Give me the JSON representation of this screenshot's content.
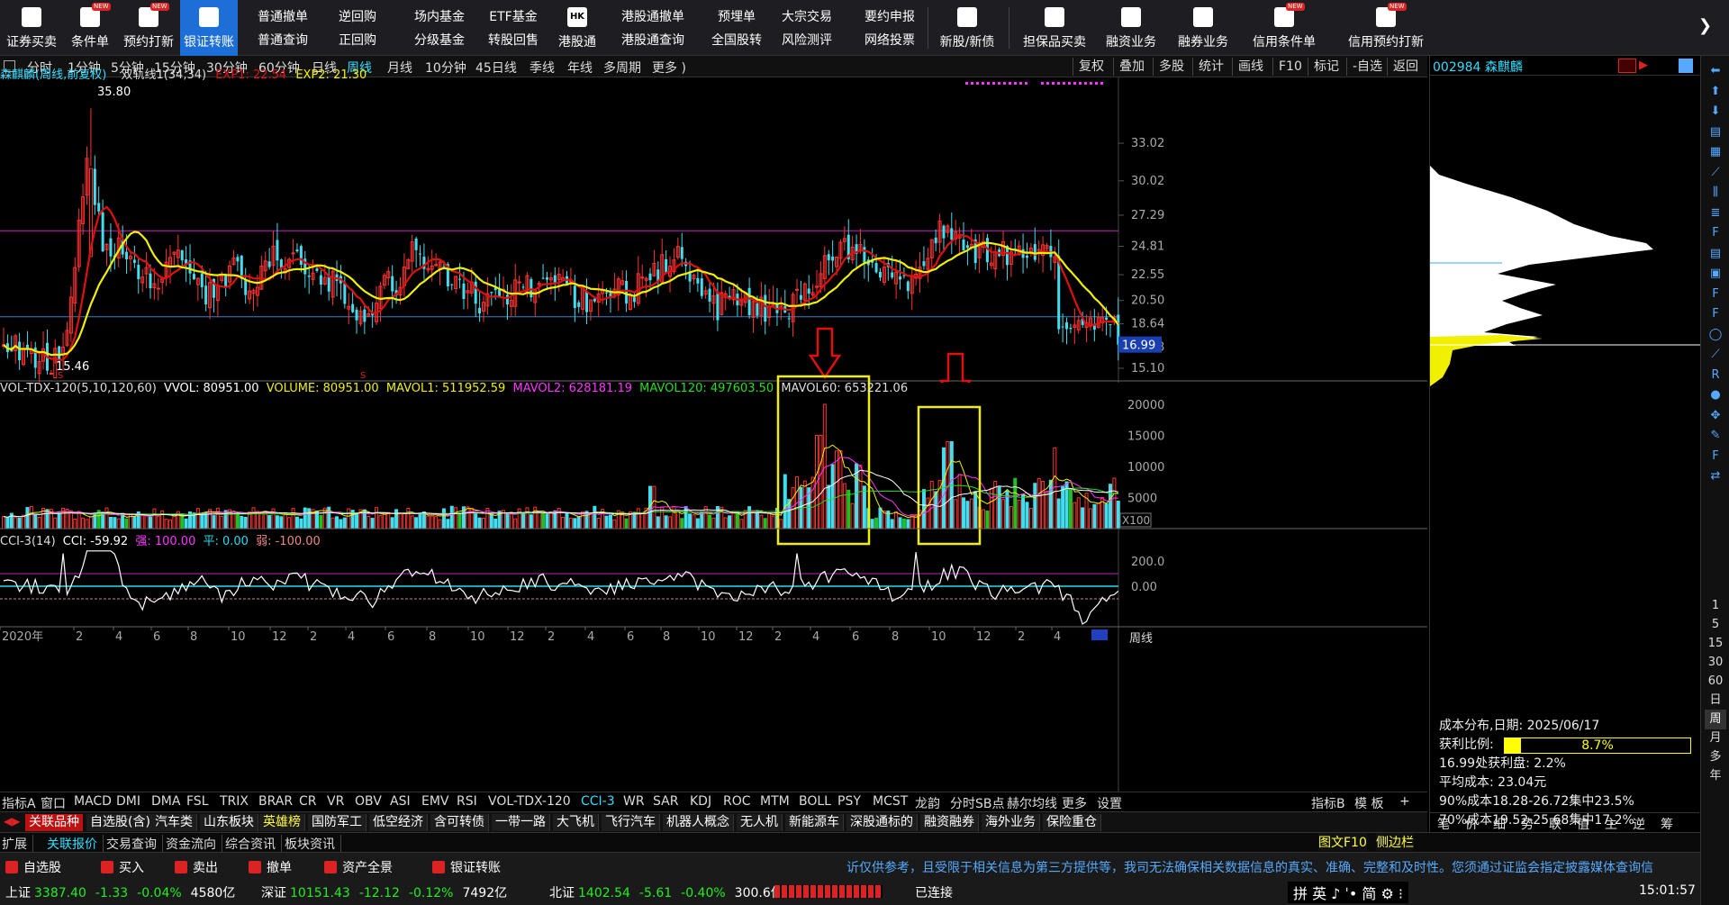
{
  "toolbar": {
    "left": [
      {
        "label": "证券买卖",
        "icon": "trade-icon",
        "new": false
      },
      {
        "label": "条件单",
        "icon": "condition-order-icon",
        "new": true
      },
      {
        "label": "预约打新",
        "icon": "ipo-reserve-icon",
        "new": true
      },
      {
        "label": "银证转账",
        "icon": "bank-transfer-icon",
        "new": false,
        "selected": true
      }
    ],
    "mid": [
      {
        "top": "普通撤单",
        "bottom": "普通查询"
      },
      {
        "top": "逆回购",
        "bottom": "正回购"
      },
      {
        "top": "场内基金",
        "bottom": "分级基金"
      },
      {
        "top": "ETF基金",
        "bottom": "转股回售"
      },
      {
        "top": "HK",
        "bottom": "港股通",
        "iconcol": true
      },
      {
        "top": "港股通撤单",
        "bottom": "港股通查询"
      },
      {
        "top": "预埋单",
        "bottom": "全国股转"
      },
      {
        "top": "大宗交易",
        "bottom": "风险测评"
      },
      {
        "top": "要约申报",
        "bottom": "网络投票"
      }
    ],
    "right": [
      {
        "label": "新股/新债",
        "icon": "new-stock-icon",
        "new": false
      },
      {
        "label": "担保品买卖",
        "icon": "collateral-icon",
        "new": false
      },
      {
        "label": "融资业务",
        "icon": "margin-financing-icon",
        "new": false
      },
      {
        "label": "融券业务",
        "icon": "securities-lending-icon",
        "new": false
      },
      {
        "label": "信用条件单",
        "icon": "credit-condition-icon",
        "new": true
      },
      {
        "label": "信用预约打新",
        "icon": "credit-ipo-icon",
        "new": true
      }
    ],
    "new_badge": "NEW",
    "hk_icon_text": "HK",
    "more": "❯"
  },
  "periods": [
    "分时",
    "1分钟",
    "5分钟",
    "15分钟",
    "30分钟",
    "60分钟",
    "日线",
    "周线",
    "月线",
    "10分钟",
    "45日线",
    "季线",
    "年线",
    "多周期",
    "更多 )"
  ],
  "period_selected": "周线",
  "right_tools": [
    "复权",
    "叠加",
    "多股",
    "统计",
    "画线",
    "F10",
    "标记",
    "-自选",
    "返回"
  ],
  "main_header": {
    "name": "森麒麟",
    "mode": "(周线,前复权)",
    "indicator": "双轨线1(34,34)",
    "exp1": "EXP1: 22.54",
    "exp2": "EXP2: 21.30"
  },
  "price_axis": [
    "33.02",
    "30.02",
    "27.29",
    "24.81",
    "22.55",
    "20.50",
    "18.64",
    "16.78",
    "15.10"
  ],
  "current_price": "16.99",
  "price_marks": {
    "high": "35.80",
    "low": "15.46"
  },
  "vol_header": {
    "name": "VOL-TDX-120(5,10,120,60)",
    "vvol": "VVOL: 80951.00",
    "volume": "VOLUME: 80951.00",
    "mavol1": "MAVOL1: 511952.59",
    "mavol2": "MAVOL2: 628181.19",
    "mavol120": "MAVOL120: 497603.50",
    "mavol60": "MAVOL60: 653221.06"
  },
  "vol_axis": [
    "20000",
    "15000",
    "10000",
    "5000"
  ],
  "vol_unit": "X100",
  "cci_header": {
    "name": "CCI-3(14)",
    "cci": "CCI: -59.92",
    "strong": "强: 100.00",
    "flat": "平: 0.00",
    "weak": "弱: -100.00"
  },
  "cci_axis": [
    "200.0",
    "0.00"
  ],
  "date_axis": [
    "2020年",
    "2",
    "4",
    "6",
    "8",
    "10",
    "12",
    "2",
    "4",
    "6",
    "8",
    "10",
    "12",
    "2",
    "4",
    "6",
    "8",
    "10",
    "12",
    "2",
    "4",
    "6",
    "8",
    "10",
    "12",
    "2",
    "4"
  ],
  "period_tag": "周线",
  "indicator_tabs": [
    "指标A",
    "窗口",
    "MACD",
    "DMI",
    "DMA",
    "FSL",
    "TRIX",
    "BRAR",
    "CR",
    "VR",
    "OBV",
    "ASI",
    "EMV",
    "RSI",
    "VOL-TDX-120",
    "CCI-3",
    "WR",
    "SAR",
    "KDJ",
    "ROC",
    "MTM",
    "BOLL",
    "PSY",
    "MCST",
    "龙韵",
    "分时SB点",
    "赫尔均线",
    "更多",
    "设置"
  ],
  "indicator_selected": "CCI-3",
  "indicator_right": [
    "指标B",
    "模 板",
    "+",
    "<"
  ],
  "block_tabs": [
    "关联品种",
    "自选股(含)",
    "汽车类",
    "山东板块",
    "英雄榜",
    "国防军工",
    "低空经济",
    "含可转债",
    "一带一路",
    "大飞机",
    "飞行汽车",
    "机器人概念",
    "无人机",
    "新能源车",
    "深股通标的",
    "融资融券",
    "海外业务",
    "保险重仓"
  ],
  "func_tabs": [
    "扩展",
    "关联报价",
    "交易查询",
    "资金流向",
    "综合资讯",
    "板块资讯"
  ],
  "right_panel": {
    "title": "002984 森麒麟",
    "cost_date": "成本分布,日期: 2025/06/17",
    "profit_label": "获利比例:",
    "profit_value": "8.7%",
    "profit_ratio": 0.087,
    "lines": [
      "16.99处获利盘: 2.2%",
      "平均成本: 23.04元",
      "90%成本18.28-26.72集中23.5%",
      "70%成本19.52-25.68集中17.2%"
    ],
    "tabs": [
      "笔",
      "价",
      "细",
      "势",
      "联",
      "值",
      "主",
      "逆",
      "筹"
    ]
  },
  "side_right": [
    "1",
    "5",
    "15",
    "30",
    "60",
    "日",
    "周",
    "月",
    "多",
    "年"
  ],
  "side_right_selected": "周",
  "status": {
    "actions": [
      "自选股",
      "买入",
      "卖出",
      "撤单",
      "资产全景",
      "银证转账"
    ],
    "notice": "䜣仅供参考，且受限于相关信息为第三方提供等，我司无法确保相关数据信息的真实、准确、完整和及时性。您须通过证监会指定披露媒体查询信",
    "indices": [
      {
        "name": "上证",
        "value": "3387.40",
        "chg": "-1.33",
        "pct": "-0.04%",
        "amt": "4580亿"
      },
      {
        "name": "深证",
        "value": "10151.43",
        "chg": "-12.12",
        "pct": "-0.12%",
        "amt": "7492亿"
      },
      {
        "name": "北证",
        "value": "1402.54",
        "chg": "-5.61",
        "pct": "-0.40%",
        "amt": "300.6亿"
      }
    ],
    "connected": "已连接",
    "ime": "拼 英 ♪ ˈ• 简 ⚙ ⁝",
    "time": "15:01:57",
    "tuwen": "图文F10",
    "sidebar": "侧边栏"
  },
  "colors": {
    "ma_red": "#e01010",
    "ma_yellow": "#f0f000",
    "bull": "#ff3333",
    "bear": "#44ddee",
    "magenta": "#ff33ff",
    "accent": "#1d6fd8"
  }
}
